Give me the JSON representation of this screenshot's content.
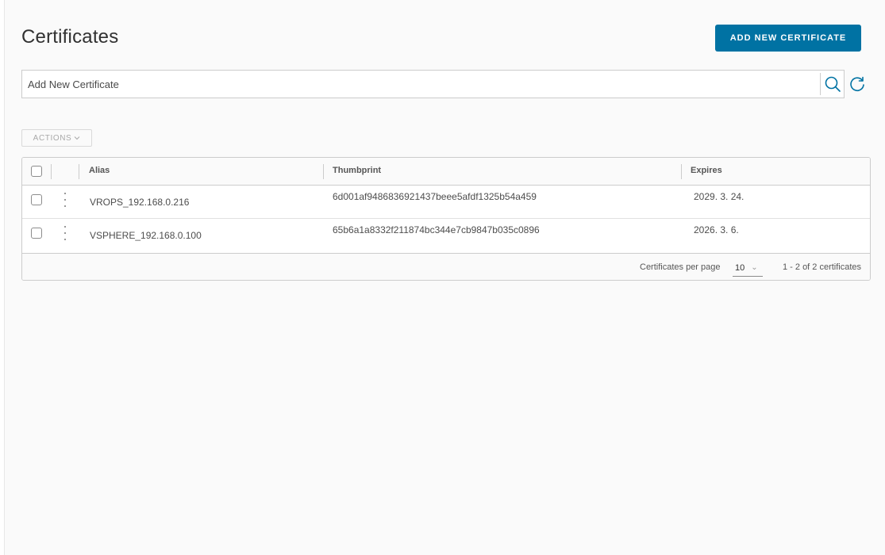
{
  "header": {
    "title": "Certificates",
    "add_button_label": "ADD NEW CERTIFICATE"
  },
  "search": {
    "placeholder": "Add New Certificate",
    "search_icon": "search-icon",
    "refresh_icon": "refresh-icon"
  },
  "toolbar": {
    "actions_label": "ACTIONS",
    "actions_icon": "chevron-down-icon"
  },
  "table": {
    "columns": {
      "alias": "Alias",
      "thumbprint": "Thumbprint",
      "expires": "Expires"
    },
    "rows": [
      {
        "alias": "VROPS_192.168.0.216",
        "thumbprint": "6d001af9486836921437beee5afdf1325b54a459",
        "expires": "2029. 3. 24."
      },
      {
        "alias": "VSPHERE_192.168.0.100",
        "thumbprint": "65b6a1a8332f211874bc344e7cb9847b035c0896",
        "expires": "2026. 3. 6."
      }
    ],
    "footer": {
      "per_page_label": "Certificates per page",
      "per_page_value": "10",
      "range_label": "1 - 2 of 2 certificates"
    }
  },
  "colors": {
    "primary_button": "#0072a3",
    "icon_blue": "#0072a3"
  }
}
